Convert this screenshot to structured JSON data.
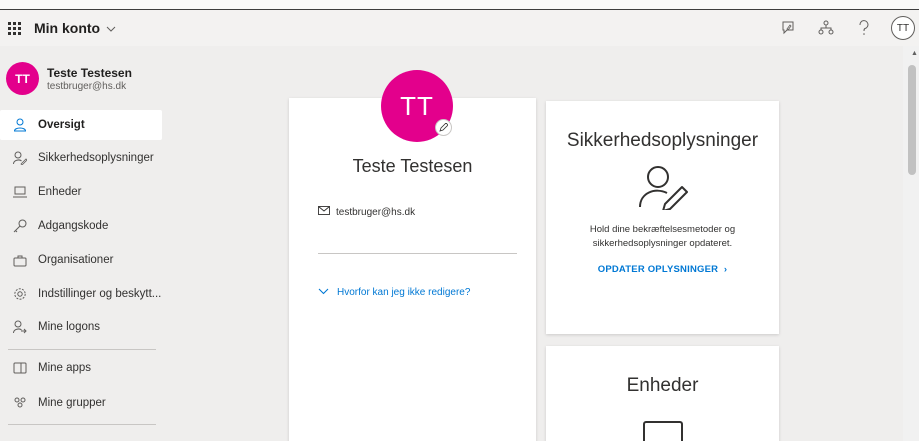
{
  "header": {
    "app_title": "Min konto",
    "user_initials": "TT",
    "icons": [
      "feedback-icon",
      "org-chart-icon",
      "help-icon"
    ]
  },
  "sidebar": {
    "user_name": "Teste Testesen",
    "user_email": "testbruger@hs.dk",
    "user_initials": "TT",
    "items": [
      {
        "label": "Oversigt",
        "icon": "person-icon",
        "active": true
      },
      {
        "label": "Sikkerhedsoplysninger",
        "icon": "security-info-icon",
        "active": false
      },
      {
        "label": "Enheder",
        "icon": "laptop-icon",
        "active": false
      },
      {
        "label": "Adgangskode",
        "icon": "key-icon",
        "active": false
      },
      {
        "label": "Organisationer",
        "icon": "briefcase-icon",
        "active": false
      },
      {
        "label": "Indstillinger og beskytt...",
        "icon": "gear-icon",
        "active": false
      },
      {
        "label": "Mine logons",
        "icon": "sign-ins-icon",
        "active": false
      },
      {
        "label": "Mine apps",
        "icon": "apps-icon",
        "active": false
      },
      {
        "label": "Mine grupper",
        "icon": "groups-icon",
        "active": false
      }
    ]
  },
  "profile": {
    "initials": "TT",
    "name": "Teste Testesen",
    "email": "testbruger@hs.dk",
    "why_link": "Hvorfor kan jeg ikke redigere?"
  },
  "security_card": {
    "title": "Sikkerhedsoplysninger",
    "description": "Hold dine bekræftelsesmetoder og sikkerhedsoplysninger opdateret.",
    "link": "OPDATER OPLYSNINGER"
  },
  "devices_card": {
    "title": "Enheder"
  },
  "colors": {
    "accent": "#0078d4",
    "avatar": "#e3008c",
    "background": "#efeeed"
  }
}
